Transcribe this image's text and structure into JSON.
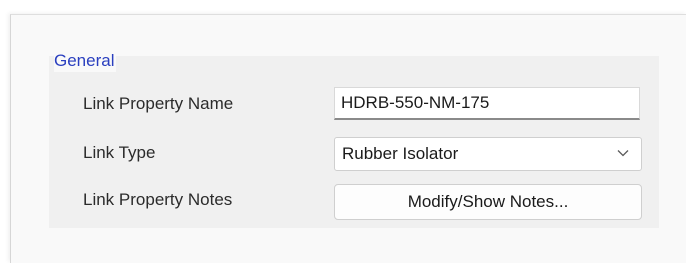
{
  "general_group": {
    "title": "General",
    "link_property_name": {
      "label": "Link Property Name",
      "value": "HDRB-550-NM-175"
    },
    "link_type": {
      "label": "Link Type",
      "selected": "Rubber Isolator",
      "icon": "chevron-down-icon"
    },
    "link_property_notes": {
      "label": "Link Property Notes",
      "button_label": "Modify/Show Notes..."
    }
  }
}
